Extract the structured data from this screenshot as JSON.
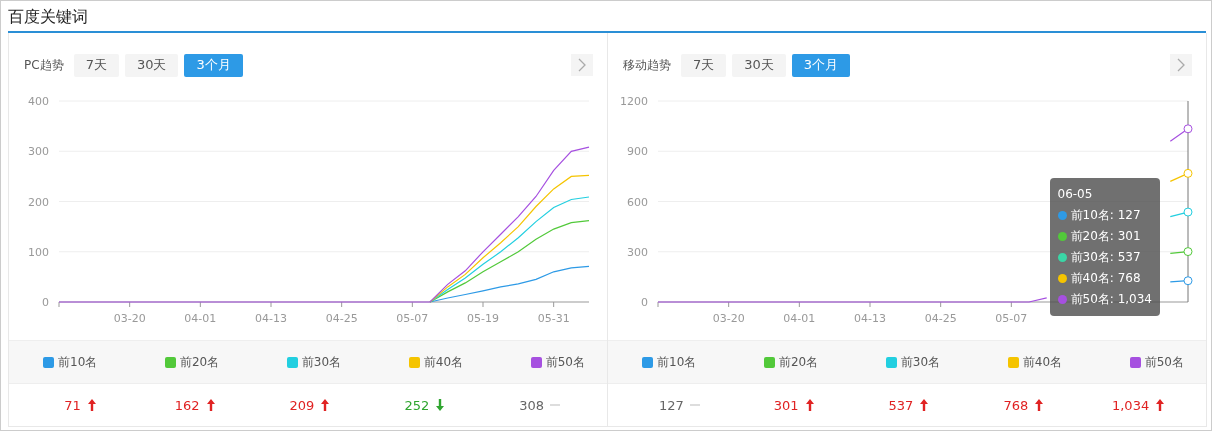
{
  "title": "百度关键词",
  "panels": [
    {
      "label": "PC趋势",
      "tabs": [
        {
          "label": "7天",
          "selected": false
        },
        {
          "label": "30天",
          "selected": false
        },
        {
          "label": "3个月",
          "selected": true
        }
      ],
      "chart_data": {
        "type": "line",
        "grid": true,
        "ylim": [
          0,
          400
        ],
        "yticks": [
          0,
          100,
          200,
          300,
          400
        ],
        "categories": [
          null,
          null,
          null,
          null,
          "03-20",
          null,
          null,
          null,
          "04-01",
          null,
          null,
          null,
          "04-13",
          null,
          null,
          null,
          "04-25",
          null,
          null,
          null,
          "05-07",
          null,
          null,
          null,
          "05-19",
          null,
          null,
          null,
          "05-31",
          null,
          null
        ],
        "series": [
          {
            "name": "前10名",
            "color": "#2d9ae6",
            "values": [
              null,
              null,
              null,
              null,
              null,
              null,
              null,
              null,
              null,
              null,
              null,
              null,
              null,
              null,
              null,
              null,
              null,
              null,
              null,
              null,
              null,
              0,
              8,
              15,
              22,
              30,
              36,
              45,
              60,
              68,
              71
            ]
          },
          {
            "name": "前20名",
            "color": "#52c93a",
            "values": [
              null,
              null,
              null,
              null,
              null,
              null,
              null,
              null,
              null,
              null,
              null,
              null,
              null,
              null,
              null,
              null,
              null,
              null,
              null,
              null,
              null,
              0,
              20,
              38,
              60,
              80,
              100,
              125,
              145,
              158,
              162
            ]
          },
          {
            "name": "前30名",
            "color": "#22cfe0",
            "values": [
              null,
              null,
              null,
              null,
              null,
              null,
              null,
              null,
              null,
              null,
              null,
              null,
              null,
              null,
              null,
              null,
              null,
              null,
              null,
              null,
              null,
              0,
              25,
              48,
              75,
              100,
              128,
              160,
              188,
              204,
              209
            ]
          },
          {
            "name": "前40名",
            "color": "#f5c400",
            "values": [
              null,
              null,
              null,
              null,
              null,
              null,
              null,
              null,
              null,
              null,
              null,
              null,
              null,
              null,
              null,
              null,
              null,
              null,
              null,
              null,
              null,
              0,
              30,
              55,
              88,
              118,
              150,
              190,
              225,
              250,
              252
            ]
          },
          {
            "name": "前50名",
            "color": "#a650e0",
            "values": [
              0,
              0,
              0,
              0,
              0,
              0,
              0,
              0,
              0,
              0,
              0,
              0,
              0,
              0,
              0,
              0,
              0,
              0,
              0,
              0,
              0,
              0,
              35,
              62,
              100,
              135,
              170,
              210,
              262,
              300,
              308
            ]
          }
        ]
      },
      "stats": [
        {
          "value": "71",
          "kind": "up"
        },
        {
          "value": "162",
          "kind": "up"
        },
        {
          "value": "209",
          "kind": "up"
        },
        {
          "value": "252",
          "kind": "down"
        },
        {
          "value": "308",
          "kind": "flat"
        }
      ]
    },
    {
      "label": "移动趋势",
      "tabs": [
        {
          "label": "7天",
          "selected": false
        },
        {
          "label": "30天",
          "selected": false
        },
        {
          "label": "3个月",
          "selected": true
        }
      ],
      "chart_data": {
        "type": "line",
        "grid": true,
        "ylim": [
          0,
          1200
        ],
        "yticks": [
          0,
          300,
          600,
          900,
          1200
        ],
        "categories": [
          null,
          null,
          null,
          null,
          "03-20",
          null,
          null,
          null,
          "04-01",
          null,
          null,
          null,
          "04-13",
          null,
          null,
          null,
          "04-25",
          null,
          null,
          null,
          "05-07",
          null,
          null,
          null,
          null,
          null,
          null,
          null,
          null,
          null,
          null
        ],
        "series": [
          {
            "name": "前10名",
            "color": "#2d9ae6",
            "values": [
              null,
              null,
              null,
              null,
              null,
              null,
              null,
              null,
              null,
              null,
              null,
              null,
              null,
              null,
              null,
              null,
              null,
              null,
              null,
              null,
              null,
              null,
              null,
              null,
              null,
              null,
              null,
              null,
              null,
              120,
              127
            ]
          },
          {
            "name": "前20名",
            "color": "#52c93a",
            "values": [
              null,
              null,
              null,
              null,
              null,
              null,
              null,
              null,
              null,
              null,
              null,
              null,
              null,
              null,
              null,
              null,
              null,
              null,
              null,
              null,
              null,
              null,
              null,
              null,
              null,
              null,
              null,
              null,
              null,
              290,
              301
            ]
          },
          {
            "name": "前30名",
            "color": "#22cfe0",
            "values": [
              null,
              null,
              null,
              null,
              null,
              null,
              null,
              null,
              null,
              null,
              null,
              null,
              null,
              null,
              null,
              null,
              null,
              null,
              null,
              null,
              null,
              null,
              null,
              null,
              null,
              null,
              null,
              null,
              null,
              510,
              537
            ]
          },
          {
            "name": "前40名",
            "color": "#f5c400",
            "values": [
              null,
              null,
              null,
              null,
              null,
              null,
              null,
              null,
              null,
              null,
              null,
              null,
              null,
              null,
              null,
              null,
              null,
              null,
              null,
              null,
              null,
              null,
              null,
              null,
              null,
              null,
              null,
              null,
              null,
              720,
              768
            ]
          },
          {
            "name": "前50名",
            "color": "#a650e0",
            "values": [
              0,
              0,
              0,
              0,
              0,
              0,
              0,
              0,
              0,
              0,
              0,
              0,
              0,
              0,
              0,
              0,
              0,
              0,
              0,
              0,
              0,
              0,
              25,
              null,
              null,
              null,
              null,
              null,
              null,
              960,
              1034
            ]
          }
        ]
      },
      "tooltip": {
        "title": "06-05",
        "lines": [
          {
            "label": "前10名: 127",
            "color": "#2d9ae6"
          },
          {
            "label": "前20名: 301",
            "color": "#52c93a"
          },
          {
            "label": "前30名: 537",
            "color": "#3ad6a6"
          },
          {
            "label": "前40名: 768",
            "color": "#f5c400"
          },
          {
            "label": "前50名: 1,034",
            "color": "#a650e0"
          }
        ]
      },
      "stats": [
        {
          "value": "127",
          "kind": "flat"
        },
        {
          "value": "301",
          "kind": "up"
        },
        {
          "value": "537",
          "kind": "up"
        },
        {
          "value": "768",
          "kind": "up"
        },
        {
          "value": "1,034",
          "kind": "up"
        }
      ]
    }
  ]
}
